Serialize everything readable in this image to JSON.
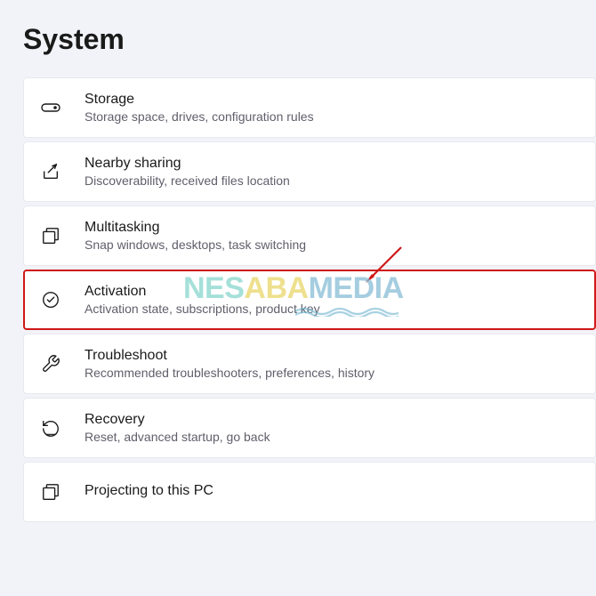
{
  "page": {
    "title": "System"
  },
  "items": [
    {
      "title": "Storage",
      "subtitle": "Storage space, drives, configuration rules",
      "icon": "storage-icon",
      "highlighted": false
    },
    {
      "title": "Nearby sharing",
      "subtitle": "Discoverability, received files location",
      "icon": "share-icon",
      "highlighted": false
    },
    {
      "title": "Multitasking",
      "subtitle": "Snap windows, desktops, task switching",
      "icon": "multitasking-icon",
      "highlighted": false
    },
    {
      "title": "Activation",
      "subtitle": "Activation state, subscriptions, product key",
      "icon": "activation-icon",
      "highlighted": true
    },
    {
      "title": "Troubleshoot",
      "subtitle": "Recommended troubleshooters, preferences, history",
      "icon": "troubleshoot-icon",
      "highlighted": false
    },
    {
      "title": "Recovery",
      "subtitle": "Reset, advanced startup, go back",
      "icon": "recovery-icon",
      "highlighted": false
    },
    {
      "title": "Projecting to this PC",
      "subtitle": "",
      "icon": "projecting-icon",
      "highlighted": false
    }
  ],
  "watermark": {
    "nes": "NES",
    "aba": "ABA",
    "media": "MEDIA"
  }
}
